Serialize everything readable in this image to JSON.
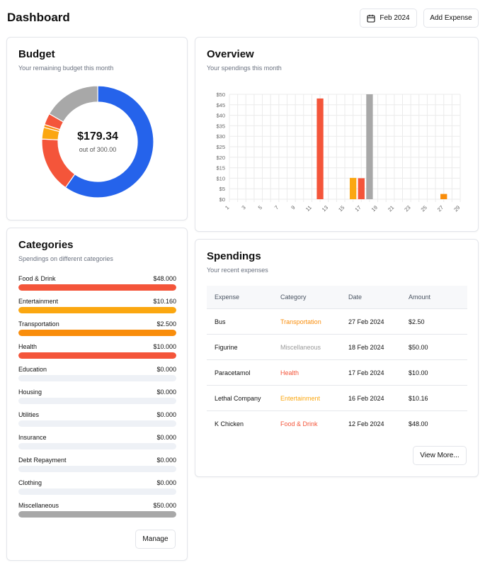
{
  "header": {
    "title": "Dashboard",
    "date_label": "Feb 2024",
    "add_label": "Add Expense"
  },
  "budget": {
    "title": "Budget",
    "subtitle": "Your remaining budget this month",
    "amount": "$179.34",
    "out_of": "out of 300.00",
    "chart_data": {
      "type": "pie",
      "segments": [
        {
          "name": "Remaining",
          "value": 179.34,
          "color": "#2563eb"
        },
        {
          "name": "Food & Drink",
          "value": 48.0,
          "color": "#f4553a"
        },
        {
          "name": "Entertainment",
          "value": 10.16,
          "color": "#fba710"
        },
        {
          "name": "Transportation",
          "value": 2.5,
          "color": "#f98d0b"
        },
        {
          "name": "Health",
          "value": 10.0,
          "color": "#f4553a"
        },
        {
          "name": "Miscellaneous",
          "value": 50.0,
          "color": "#a8a8a8"
        }
      ]
    }
  },
  "overview": {
    "title": "Overview",
    "subtitle": "Your spendings this month",
    "chart_data": {
      "type": "bar",
      "x_ticks": [
        "1",
        "3",
        "5",
        "7",
        "9",
        "11",
        "13",
        "15",
        "17",
        "19",
        "21",
        "23",
        "25",
        "27",
        "29"
      ],
      "y_ticks": [
        "$0",
        "$5",
        "$10",
        "$15",
        "$20",
        "$25",
        "$30",
        "$35",
        "$40",
        "$45",
        "$50"
      ],
      "ylim": [
        0,
        50
      ],
      "xlim": [
        1,
        29
      ],
      "bars": [
        {
          "day": 12,
          "value": 48.0,
          "color": "#f4553a"
        },
        {
          "day": 16,
          "value": 10.16,
          "color": "#fba710"
        },
        {
          "day": 17,
          "value": 10.0,
          "color": "#f4553a"
        },
        {
          "day": 18,
          "value": 50.0,
          "color": "#a8a8a8"
        },
        {
          "day": 27,
          "value": 2.5,
          "color": "#f98d0b"
        }
      ]
    }
  },
  "categories": {
    "title": "Categories",
    "subtitle": "Spendings on different categories",
    "manage_label": "Manage",
    "items": [
      {
        "name": "Food & Drink",
        "amount": "$48.000",
        "fill": 1.0,
        "color": "#f4553a"
      },
      {
        "name": "Entertainment",
        "amount": "$10.160",
        "fill": 1.0,
        "color": "#fba710"
      },
      {
        "name": "Transportation",
        "amount": "$2.500",
        "fill": 1.0,
        "color": "#f98d0b"
      },
      {
        "name": "Health",
        "amount": "$10.000",
        "fill": 1.0,
        "color": "#f4553a"
      },
      {
        "name": "Education",
        "amount": "$0.000",
        "fill": 0,
        "color": "#eef1f6"
      },
      {
        "name": "Housing",
        "amount": "$0.000",
        "fill": 0,
        "color": "#eef1f6"
      },
      {
        "name": "Utilities",
        "amount": "$0.000",
        "fill": 0,
        "color": "#eef1f6"
      },
      {
        "name": "Insurance",
        "amount": "$0.000",
        "fill": 0,
        "color": "#eef1f6"
      },
      {
        "name": "Debt Repayment",
        "amount": "$0.000",
        "fill": 0,
        "color": "#eef1f6"
      },
      {
        "name": "Clothing",
        "amount": "$0.000",
        "fill": 0,
        "color": "#eef1f6"
      },
      {
        "name": "Miscellaneous",
        "amount": "$50.000",
        "fill": 1.0,
        "color": "#a8a8a8"
      }
    ]
  },
  "spendings": {
    "title": "Spendings",
    "subtitle": "Your recent expenses",
    "columns": [
      "Expense",
      "Category",
      "Date",
      "Amount"
    ],
    "rows": [
      {
        "expense": "Bus",
        "category": "Transportation",
        "category_color": "#f98d0b",
        "date": "27 Feb 2024",
        "amount": "$2.50"
      },
      {
        "expense": "Figurine",
        "category": "Miscellaneous",
        "category_color": "#9a9a9a",
        "date": "18 Feb 2024",
        "amount": "$50.00"
      },
      {
        "expense": "Paracetamol",
        "category": "Health",
        "category_color": "#f4553a",
        "date": "17 Feb 2024",
        "amount": "$10.00"
      },
      {
        "expense": "Lethal Company",
        "category": "Entertainment",
        "category_color": "#fba710",
        "date": "16 Feb 2024",
        "amount": "$10.16"
      },
      {
        "expense": "K Chicken",
        "category": "Food & Drink",
        "category_color": "#f4553a",
        "date": "12 Feb 2024",
        "amount": "$48.00"
      }
    ],
    "more_label": "View More..."
  }
}
